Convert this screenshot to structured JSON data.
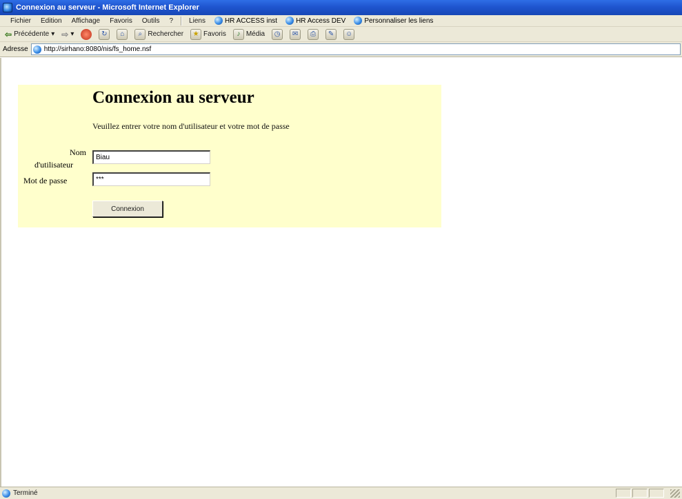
{
  "window": {
    "title": "Connexion au serveur - Microsoft Internet Explorer"
  },
  "menu": {
    "items": [
      "Fichier",
      "Edition",
      "Affichage",
      "Favoris",
      "Outils",
      "?"
    ],
    "links_label": "Liens",
    "links": [
      "HR ACCESS inst",
      "HR Access DEV",
      "Personnaliser les liens"
    ]
  },
  "toolbar": {
    "back": "Précédente",
    "search": "Rechercher",
    "favorites": "Favoris",
    "media": "Média"
  },
  "address": {
    "label": "Adresse",
    "url": "http://sirhano:8080/nis/fs_home.nsf"
  },
  "page": {
    "heading": "Connexion au serveur",
    "instruction": "Veuillez entrer votre nom d'utilisateur et votre mot de passe",
    "username_label_line1": "Nom",
    "username_label_line2": "d'utilisateur",
    "username_value": "Biau",
    "password_label": "Mot de passe",
    "password_value": "***",
    "submit_label": "Connexion",
    "panel_color": "#ffffcc"
  },
  "status": {
    "text": "Terminé"
  }
}
